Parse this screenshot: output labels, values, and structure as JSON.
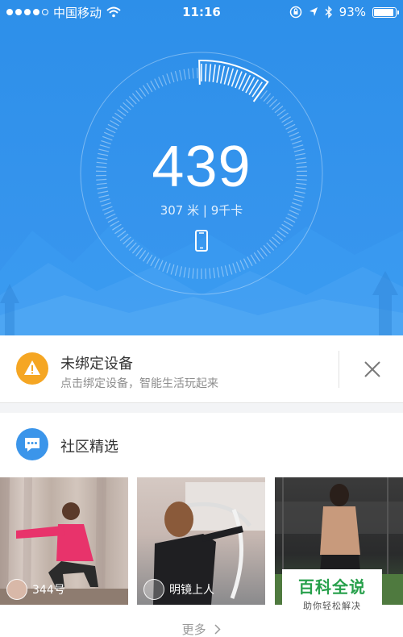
{
  "status_bar": {
    "carrier": "中国移动",
    "time": "11:16",
    "battery": "93%",
    "battery_level": 0.93,
    "signal_bars_filled": 4
  },
  "activity": {
    "steps": "439",
    "summary": "307 米 | 9千卡"
  },
  "device_card": {
    "title": "未绑定设备",
    "description": "点击绑定设备，智能生活玩起来"
  },
  "community": {
    "title": "社区精选",
    "posts": [
      {
        "user": "344号"
      },
      {
        "user": "明镜上人"
      },
      {
        "user": ""
      }
    ],
    "more_label": "更多"
  },
  "watermark": {
    "title": "百科全说",
    "subtitle": "助你轻松解决"
  },
  "colors": {
    "hero_blue": "#2d8fe9",
    "warning_orange": "#f5a623",
    "chat_blue": "#3b95ea",
    "watermark_green": "#27a04b"
  },
  "icons": [
    "wifi-icon",
    "lock-rotation-icon",
    "location-icon",
    "bluetooth-icon",
    "battery-icon",
    "phone-icon",
    "warning-icon",
    "close-icon",
    "chat-icon",
    "chevron-right-icon"
  ]
}
